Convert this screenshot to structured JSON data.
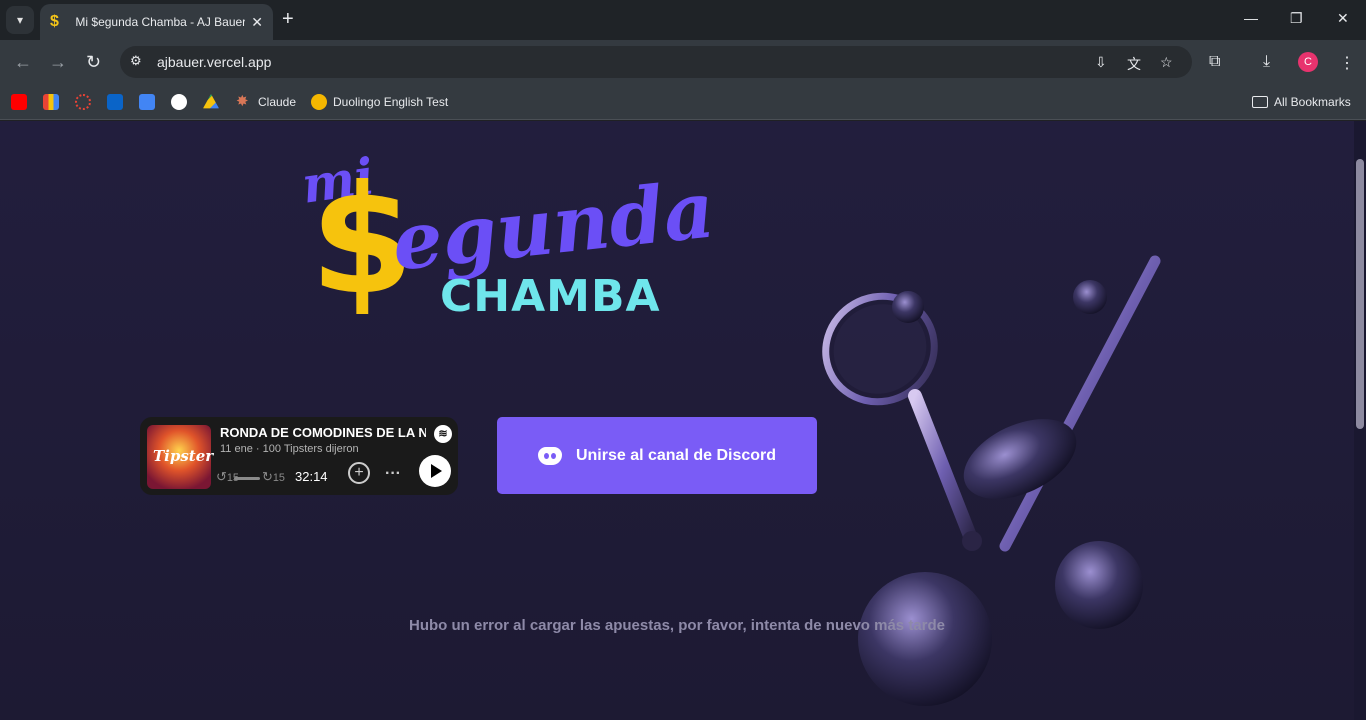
{
  "browser": {
    "tab_title": "Mi $egunda Chamba - AJ Bauer Test",
    "tab_favicon": "$",
    "url": "ajbauer.vercel.app",
    "avatar_letter": "C",
    "bookmarks": [
      {
        "label": "",
        "icon": "youtube-icon",
        "color": "#ff0000"
      },
      {
        "label": "",
        "icon": "metrics-icon",
        "color": "#f6c30d"
      },
      {
        "label": "",
        "icon": "circle-icon",
        "color": "#ea4335"
      },
      {
        "label": "",
        "icon": "outlook-icon",
        "color": "#0a64c8"
      },
      {
        "label": "",
        "icon": "docs-icon",
        "color": "#4285f4"
      },
      {
        "label": "",
        "icon": "github-icon",
        "color": "#ffffff"
      },
      {
        "label": "",
        "icon": "drive-icon",
        "color": "#34a853"
      },
      {
        "label": "Claude",
        "icon": "claude-icon",
        "color": "#d97757"
      },
      {
        "label": "Duolingo English Test",
        "icon": "duolingo-icon",
        "color": "#f5b700"
      }
    ],
    "all_bookmarks_label": "All Bookmarks"
  },
  "logo": {
    "mi": "mi",
    "dollar": "$",
    "egunda": "egunda",
    "chamba": "CHAMBA"
  },
  "player": {
    "title": "RONDA DE COMODINES DE LA NFL",
    "art_text": "Tipster",
    "date": "11 ene",
    "show": "100 Tipsters dijeron",
    "time": "32:14",
    "skip_back": "15",
    "skip_forward": "15"
  },
  "discord": {
    "label": "Unirse al canal de Discord"
  },
  "error_message": "Hubo un error al cargar las apuestas, por favor, intenta de nuevo más tarde",
  "colors": {
    "accent_purple": "#7a5cf6",
    "logo_yellow": "#f6c30d",
    "logo_cyan": "#6fe6ec",
    "page_bg": "#1e1b33"
  }
}
